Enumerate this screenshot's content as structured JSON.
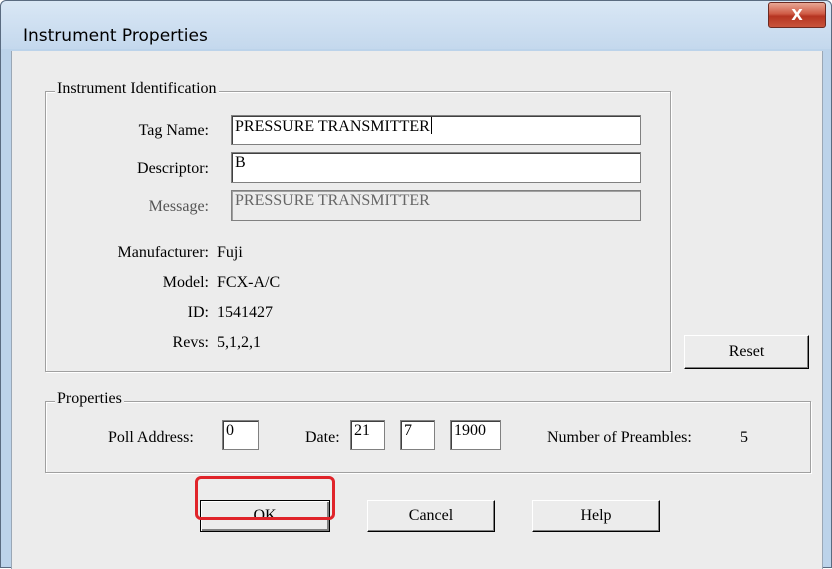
{
  "window": {
    "title": "Instrument Properties",
    "close_glyph": "X"
  },
  "identification": {
    "legend": "Instrument Identification",
    "tag_name_label": "Tag Name:",
    "tag_name_value": "PRESSURE TRANSMITTER",
    "descriptor_label": "Descriptor:",
    "descriptor_value": "B",
    "message_label": "Message:",
    "message_value": "PRESSURE TRANSMITTER",
    "manufacturer_label": "Manufacturer:",
    "manufacturer_value": "Fuji",
    "model_label": "Model:",
    "model_value": "FCX-A/C",
    "id_label": "ID:",
    "id_value": "1541427",
    "revs_label": "Revs:",
    "revs_value": "5,1,2,1"
  },
  "properties": {
    "legend": "Properties",
    "poll_address_label": "Poll Address:",
    "poll_address_value": "0",
    "date_label": "Date:",
    "date_day": "21",
    "date_month": "7",
    "date_year": "1900",
    "preambles_label": "Number of Preambles:",
    "preambles_value": "5"
  },
  "buttons": {
    "reset": "Reset",
    "ok": "OK",
    "cancel": "Cancel",
    "help": "Help"
  },
  "highlight_color": "#e0242a"
}
